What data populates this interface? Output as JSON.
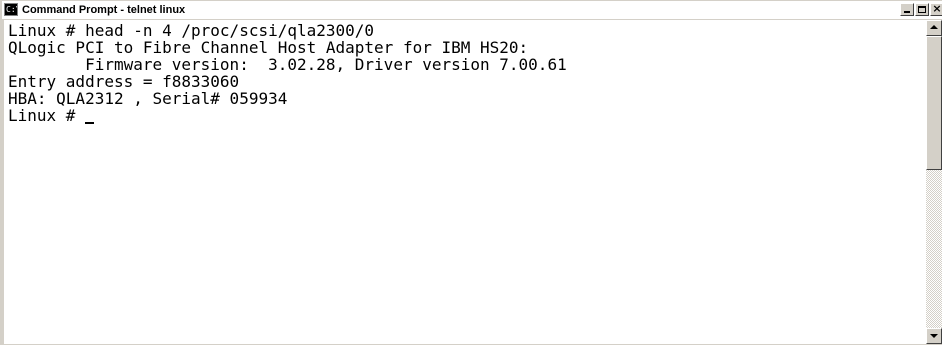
{
  "window": {
    "title": "Command Prompt - telnet linux",
    "title_icon": "cmd-icon",
    "buttons": {
      "minimize": "minimize-icon",
      "maximize": "maximize-icon",
      "close_label": "×"
    }
  },
  "console": {
    "lines": [
      "Linux # head -n 4 /proc/scsi/qla2300/0",
      "QLogic PCI to Fibre Channel Host Adapter for IBM HS20:",
      "        Firmware version:  3.02.28, Driver version 7.00.61",
      "Entry address = f8833060",
      "HBA: QLA2312 , Serial# 059934",
      "Linux # "
    ]
  },
  "scrollbar": {
    "position_fraction": 0.0
  }
}
